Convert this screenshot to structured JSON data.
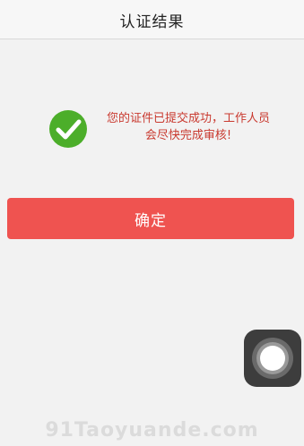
{
  "header": {
    "title": "认证结果"
  },
  "result": {
    "icon": "check-circle-icon",
    "icon_color": "#4cae2a",
    "line1": "您的证件已提交成功，工作人员",
    "line2": "会尽快完成审核!",
    "text_color": "#c9392f"
  },
  "actions": {
    "confirm_label": "确定",
    "confirm_color": "#ef5350"
  },
  "overlay": {
    "assistive_touch_icon": "assistive-touch-icon"
  },
  "watermark": {
    "text": "91Taoyuande.com"
  }
}
